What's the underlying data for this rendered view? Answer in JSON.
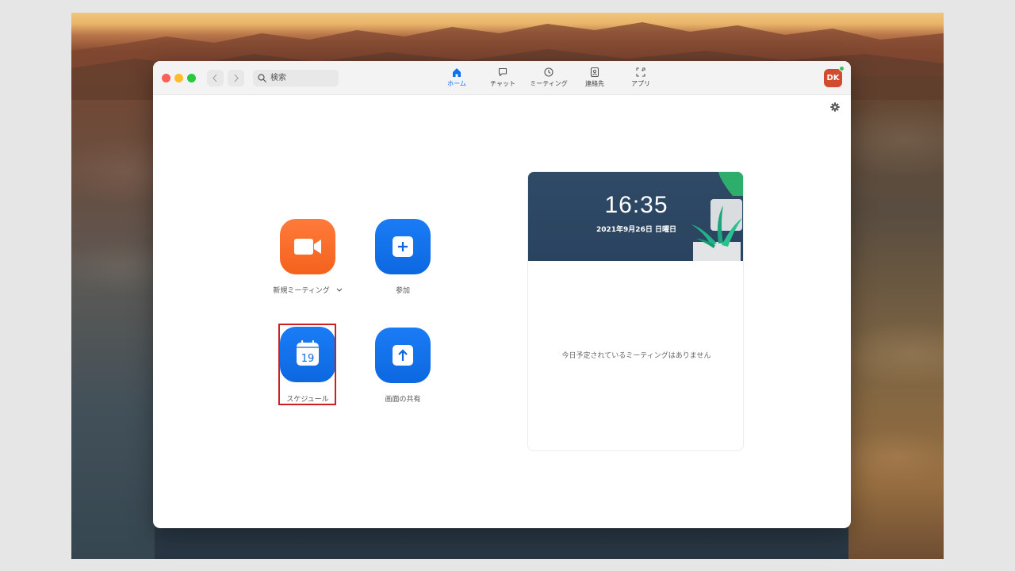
{
  "search": {
    "placeholder": "検索"
  },
  "tabs": [
    {
      "label": "ホーム",
      "icon": "home-icon",
      "active": true
    },
    {
      "label": "チャット",
      "icon": "chat-icon",
      "active": false
    },
    {
      "label": "ミーティング",
      "icon": "clock-icon",
      "active": false
    },
    {
      "label": "連絡先",
      "icon": "contacts-icon",
      "active": false
    },
    {
      "label": "アプリ",
      "icon": "apps-icon",
      "active": false
    }
  ],
  "user": {
    "initials": "DK",
    "status": "online"
  },
  "actions": {
    "new_meeting": "新規ミーティング",
    "join": "参加",
    "schedule": "スケジュール",
    "share_screen": "画面の共有",
    "calendar_day": "19"
  },
  "calendar": {
    "time": "16:35",
    "date": "2021年9月26日 日曜日",
    "empty_message": "今日予定されているミーティングはありません"
  },
  "colors": {
    "accent": "#0e72ed",
    "new_meeting_tile": "#f4621d",
    "action_tile": "#0d68e0",
    "avatar": "#d14b31",
    "highlight": "#cc1f1f"
  }
}
